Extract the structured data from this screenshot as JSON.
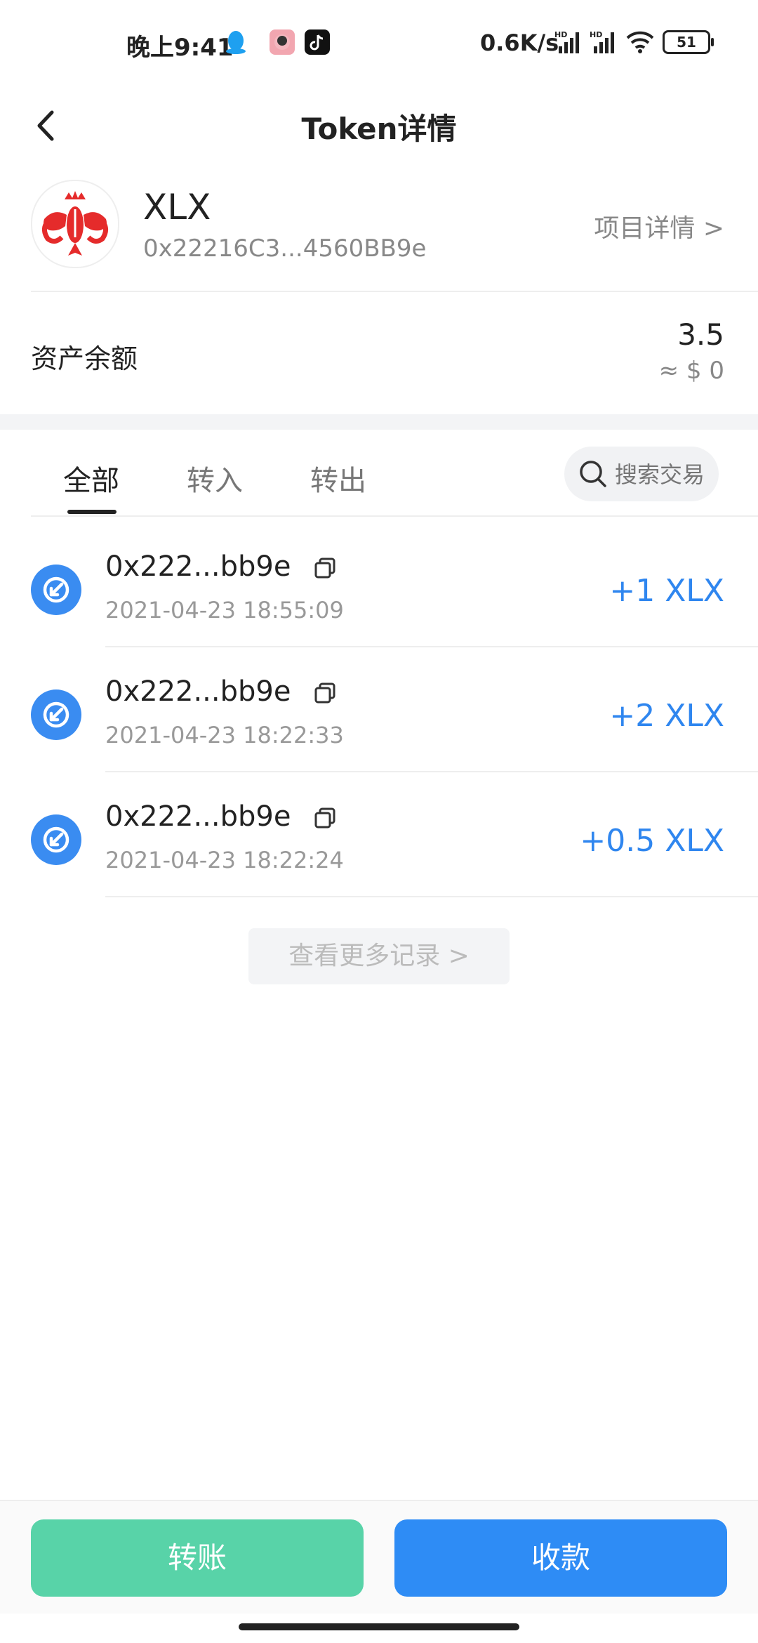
{
  "status_bar": {
    "time": "晚上9:41",
    "net_speed": "0.6K/s",
    "battery": "51"
  },
  "header": {
    "title": "Token详情"
  },
  "token": {
    "symbol": "XLX",
    "address": "0x22216C3...4560BB9e",
    "project_link": "项目详情 >"
  },
  "balance": {
    "label": "资产余额",
    "value": "3.5",
    "fiat": "≈ $ 0"
  },
  "tabs": [
    {
      "label": "全部",
      "active": true
    },
    {
      "label": "转入",
      "active": false
    },
    {
      "label": "转出",
      "active": false
    }
  ],
  "search": {
    "placeholder": "搜索交易"
  },
  "transactions": [
    {
      "address": "0x222...bb9e",
      "time": "2021-04-23 18:55:09",
      "amount": "+1 XLX"
    },
    {
      "address": "0x222...bb9e",
      "time": "2021-04-23 18:22:33",
      "amount": "+2 XLX"
    },
    {
      "address": "0x222...bb9e",
      "time": "2021-04-23 18:22:24",
      "amount": "+0.5 XLX"
    }
  ],
  "more_records": "查看更多记录 >",
  "actions": {
    "transfer": "转账",
    "receive": "收款"
  },
  "colors": {
    "accent_blue": "#2e8cf5",
    "transfer_green": "#58d3a8",
    "amount_blue": "#2f86ef"
  }
}
